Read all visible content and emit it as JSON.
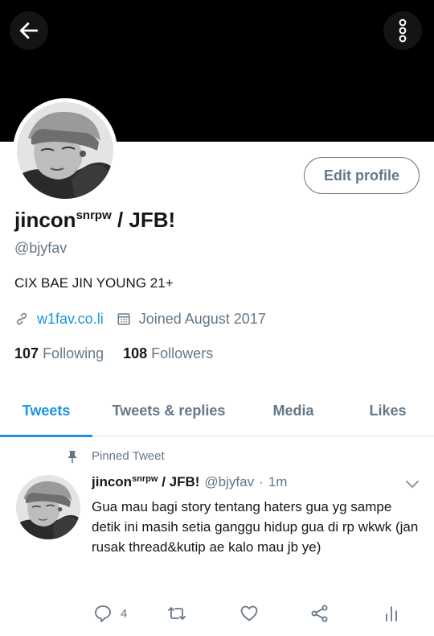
{
  "colors": {
    "accent": "#1b95e0",
    "muted": "#657786",
    "text": "#14171a",
    "banner": "#000000"
  },
  "nav": {
    "back_icon": "arrow-left-icon",
    "more_icon": "vertical-dots-icon"
  },
  "profile": {
    "edit_label": "Edit profile",
    "name_main": "jincon",
    "name_sup": "snrpw",
    "name_rest": " / JFB!",
    "handle": "@bjyfav",
    "bio": "CIX BAE JIN YOUNG 21+",
    "website": "w1fav.co.li",
    "joined": "Joined August 2017",
    "following_count": "107",
    "following_label": "Following",
    "followers_count": "108",
    "followers_label": "Followers"
  },
  "tabs": [
    {
      "label": "Tweets",
      "active": true
    },
    {
      "label": "Tweets & replies",
      "active": false
    },
    {
      "label": "Media",
      "active": false
    },
    {
      "label": "Likes",
      "active": false
    }
  ],
  "pinned_tweet": {
    "pinned_label": "Pinned Tweet",
    "author_main": "jincon",
    "author_sup": "snrpw",
    "author_rest": " / JFB!",
    "handle": "@bjyfav",
    "separator": "·",
    "time": "1m",
    "text": "Gua mau bagi story tentang haters gua yg sampe detik ini masih setia ganggu hidup gua di rp wkwk (jan rusak thread&kutip ae kalo mau jb ye)",
    "reply_count": "4"
  }
}
